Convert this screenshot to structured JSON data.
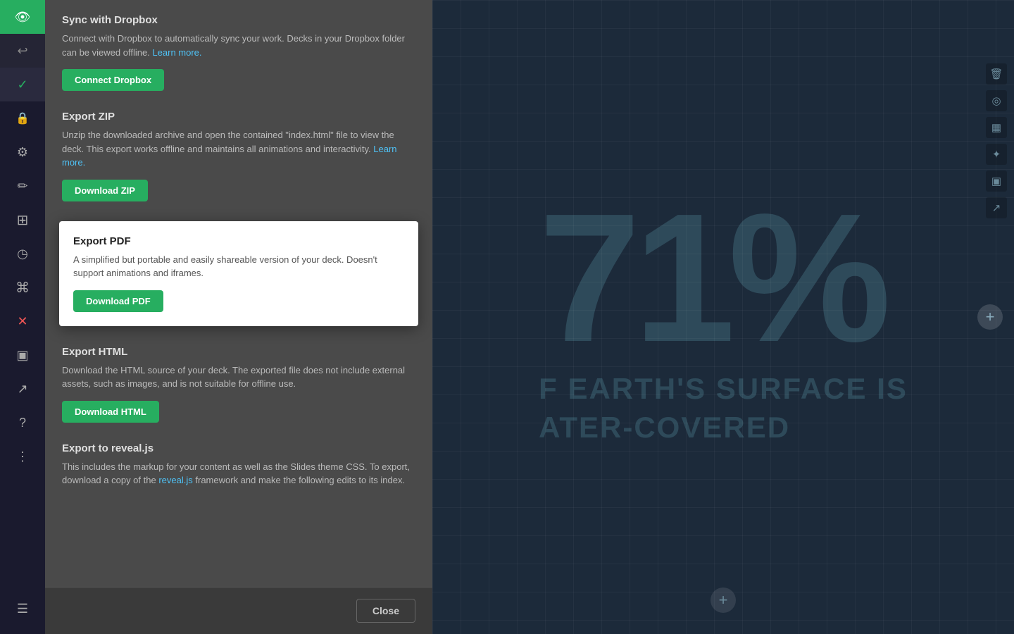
{
  "sidebar": {
    "icons": [
      {
        "name": "eye-icon",
        "symbol": "👁",
        "active": true,
        "bg": "#27ae60"
      },
      {
        "name": "undo-icon",
        "symbol": "↩",
        "active": false,
        "bg": "#252535"
      },
      {
        "name": "check-icon",
        "symbol": "✓",
        "active": false,
        "bg": "#2a2a3e"
      },
      {
        "name": "lock-icon",
        "symbol": "🔒",
        "active": false,
        "bg": ""
      },
      {
        "name": "settings-icon",
        "symbol": "⚙",
        "active": false,
        "bg": ""
      },
      {
        "name": "pencil-icon",
        "symbol": "✏",
        "active": false,
        "bg": ""
      },
      {
        "name": "layers-icon",
        "symbol": "◫",
        "active": false,
        "bg": ""
      },
      {
        "name": "clock-icon",
        "symbol": "◷",
        "active": false,
        "bg": ""
      },
      {
        "name": "tag-icon",
        "symbol": "⌘",
        "active": false,
        "bg": ""
      },
      {
        "name": "close-icon",
        "symbol": "✕",
        "active": false,
        "bg": ""
      },
      {
        "name": "book-icon",
        "symbol": "▦",
        "active": false,
        "bg": ""
      },
      {
        "name": "share-icon",
        "symbol": "↗",
        "active": false,
        "bg": ""
      },
      {
        "name": "help-icon",
        "symbol": "?",
        "active": false,
        "bg": ""
      },
      {
        "name": "more-icon",
        "symbol": "⋮",
        "active": false,
        "bg": ""
      },
      {
        "name": "menu-icon",
        "symbol": "☰",
        "active": false,
        "bg": ""
      }
    ]
  },
  "panel": {
    "sections": [
      {
        "id": "dropbox",
        "title": "Sync with Dropbox",
        "description": "Connect with Dropbox to automatically sync your work. Decks in your Dropbox folder can be viewed offline.",
        "link_text": "Learn more.",
        "button_label": "Connect Dropbox",
        "highlighted": false
      },
      {
        "id": "export-zip",
        "title": "Export ZIP",
        "description": "Unzip the downloaded archive and open the contained \"index.html\" file to view the deck. This export works offline and maintains all animations and interactivity.",
        "link_text": "Learn more.",
        "button_label": "Download ZIP",
        "highlighted": false
      },
      {
        "id": "export-pdf",
        "title": "Export PDF",
        "description": "A simplified but portable and easily shareable version of your deck. Doesn't support animations and iframes.",
        "link_text": "",
        "button_label": "Download PDF",
        "highlighted": true
      },
      {
        "id": "export-html",
        "title": "Export HTML",
        "description": "Download the HTML source of your deck. The exported file does not include external assets, such as images, and is not suitable for offline use.",
        "link_text": "",
        "button_label": "Download HTML",
        "highlighted": false
      },
      {
        "id": "export-revealjs",
        "title": "Export to reveal.js",
        "description": "This includes the markup for your content as well as the Slides theme CSS. To export, download a copy of the",
        "link_text": "reveal.js",
        "description2": "framework and make the following edits to its index.",
        "button_label": "",
        "highlighted": false
      }
    ],
    "footer": {
      "close_label": "Close"
    }
  },
  "slide": {
    "big_number": "71%",
    "line1": "F EARTH'S SURFACE IS",
    "line2": "ATER-COVERED"
  },
  "right_toolbar": {
    "icons": [
      {
        "name": "trash-icon",
        "symbol": "🗑"
      },
      {
        "name": "globe-icon",
        "symbol": "◎"
      },
      {
        "name": "chart-icon",
        "symbol": "▦"
      },
      {
        "name": "magic-icon",
        "symbol": "✦"
      },
      {
        "name": "book2-icon",
        "symbol": "▣"
      },
      {
        "name": "export-icon",
        "symbol": "↗"
      }
    ]
  },
  "colors": {
    "accent_green": "#27ae60",
    "panel_bg": "#4a4a4a",
    "slide_bg": "#1c2a3a",
    "highlighted_bg": "#ffffff",
    "link_color": "#4fc3f7"
  }
}
